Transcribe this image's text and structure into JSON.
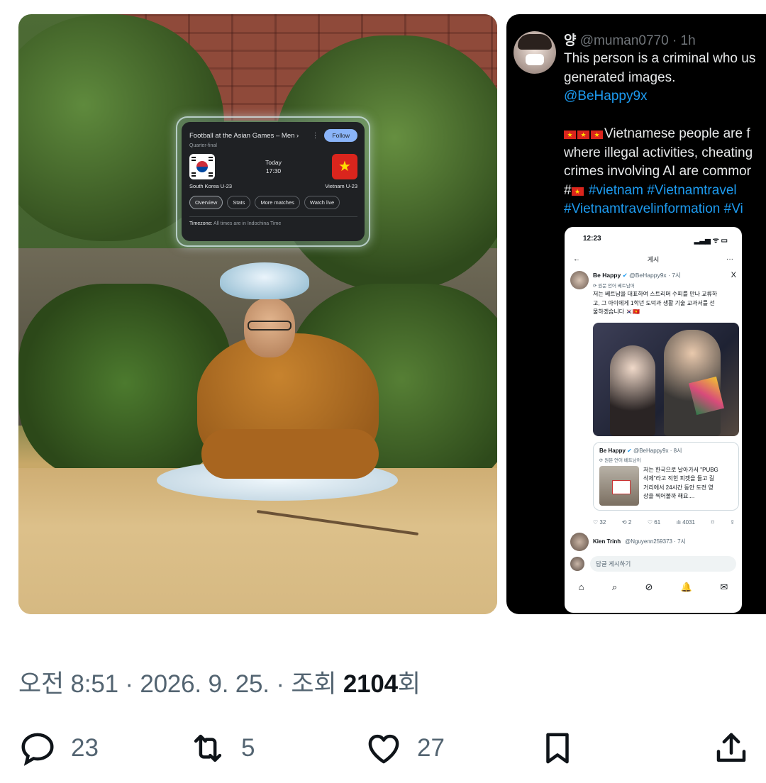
{
  "photo": {
    "card": {
      "title": "Football at the Asian Games – Men ›",
      "menu_glyph": "⋮",
      "follow_label": "Follow",
      "subtitle": "Quarter-final",
      "time_day": "Today",
      "time_clock": "17:30",
      "team_home": "South Korea U-23",
      "team_away": "Vietnam U-23",
      "away_flag_glyph": "★",
      "chips": [
        "Overview",
        "Stats",
        "More matches",
        "Watch live"
      ],
      "timezone_label": "Timezone:",
      "timezone_text": "All times are in Indochina Time"
    }
  },
  "quoted_tweet": {
    "name": "양",
    "handle_time": "@muman0770 · 1h",
    "lines": [
      "This person is a criminal who us",
      "generated images.",
      "@BeHappy9x",
      "",
      "Vietnamese people are f",
      "where illegal activities, cheating",
      "crimes involving AI are commor",
      "#vietnam #Vietnamtravel",
      "#Vietnamtravelinformation #Vi"
    ],
    "phone": {
      "clock": "12:23",
      "status_icons": "▂▃▅ ᯤ ▭",
      "back_glyph": "←",
      "page_title": "게시",
      "more_glyph": "···",
      "author_name": "Be Happy",
      "author_handle": "@BeHappy9x · 7시",
      "x_glyph": "X",
      "translated_label": "⟳ 원문 언어 베트남어",
      "body_lines": [
        "저는 베트남을 대표하여 스트리머 수피를 만나 교류하",
        "고, 그 아이에게 1학년 도덕과 생활 기술 교과서를 선",
        "물하겠습니다 🇰🇷🇻🇳"
      ],
      "quote_name": "Be Happy",
      "quote_handle": "@BeHappy9x · 8시",
      "quote_translated": "⟳ 원문 언어 베트남어",
      "quote_lines": [
        "저는 한국으로 날아가서 \"PUBG",
        "삭제\"라고 적힌 피켓을 들고 길",
        "거리에서 24시간 동안 도전 영",
        "상을 찍어볼까 해요...."
      ],
      "stats": [
        "♡ 32",
        "⟲ 2",
        "♡ 61",
        "ılı 4031",
        "⌑",
        "⇪"
      ],
      "reply_name": "Kien Trinh",
      "reply_handle": "@Nguyenn259373 · 7시",
      "input_placeholder": "답글 게시하기",
      "tabs": [
        "⌂",
        "⌕",
        "⊘",
        "🔔",
        "✉"
      ]
    }
  },
  "meta": {
    "time_date": "오전 8:51 · 2026. 9. 25. · 조회 ",
    "views": "2104",
    "views_suffix": "회"
  },
  "actions": {
    "reply_count": "23",
    "retweet_count": "5",
    "like_count": "27"
  },
  "colors": {
    "text_primary": "#0f1419",
    "text_secondary": "#536471",
    "link_blue": "#1d9bf0",
    "dark_bg": "#000000"
  }
}
